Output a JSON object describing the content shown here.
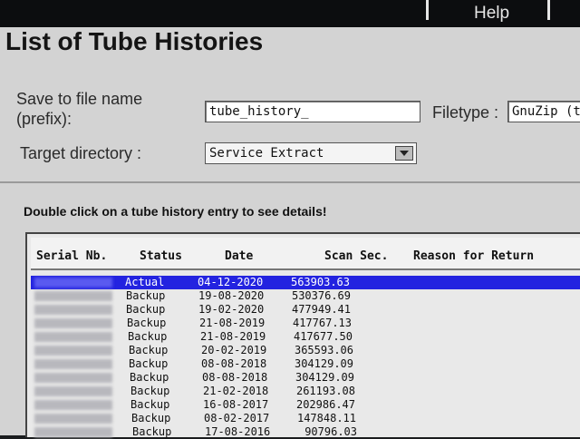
{
  "topbar": {
    "help_label": "Help"
  },
  "window": {
    "title": "List of Tube Histories",
    "save_label_line1": "Save to file name",
    "save_label_line2": "(prefix):",
    "filename_value": "tube_history_",
    "filetype_label": "Filetype :",
    "filetype_value": "GnuZip (txt",
    "target_label": "Target directory :",
    "target_value": "Service Extract",
    "hint": "Double click on a tube history entry to see details!"
  },
  "table": {
    "columns": {
      "serial": "Serial Nb.",
      "status": "Status",
      "date": "Date",
      "scan": "Scan Sec.",
      "reason": "Reason for Return"
    },
    "rows": [
      {
        "status": "Actual",
        "date": "04-12-2020",
        "scan": "563903.63",
        "selected": true
      },
      {
        "status": "Backup",
        "date": "19-08-2020",
        "scan": "530376.69"
      },
      {
        "status": "Backup",
        "date": "19-02-2020",
        "scan": "477949.41"
      },
      {
        "status": "Backup",
        "date": "21-08-2019",
        "scan": "417767.13"
      },
      {
        "status": "Backup",
        "date": "21-08-2019",
        "scan": "417677.50"
      },
      {
        "status": "Backup",
        "date": "20-02-2019",
        "scan": "365593.06"
      },
      {
        "status": "Backup",
        "date": "08-08-2018",
        "scan": "304129.09"
      },
      {
        "status": "Backup",
        "date": "08-08-2018",
        "scan": "304129.09"
      },
      {
        "status": "Backup",
        "date": "21-02-2018",
        "scan": "261193.08"
      },
      {
        "status": "Backup",
        "date": "16-08-2017",
        "scan": "202986.47"
      },
      {
        "status": "Backup",
        "date": "08-02-2017",
        "scan": "147848.11"
      },
      {
        "status": "Backup",
        "date": "17-08-2016",
        "scan": "90796.03"
      }
    ]
  },
  "colors": {
    "selection": "#2323e0",
    "window_bg": "#d3d3d3"
  }
}
